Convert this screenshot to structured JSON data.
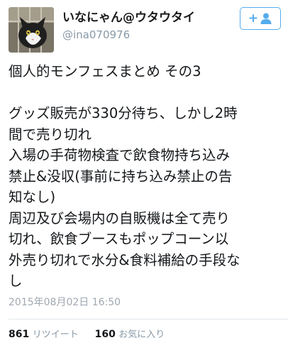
{
  "user": {
    "display_name": "いなにゃん@ウタウタイ",
    "screen_name": "@ina070976"
  },
  "follow_button": {
    "icon": "add-user-icon",
    "label": "+"
  },
  "tweet": {
    "lines": [
      "個人的モンフェスまとめ その3",
      "",
      "グッズ販売が330分待ち、しかし2時",
      "間で売り切れ",
      "入場の手荷物検査で飲食物持ち込み",
      "禁止&没収(事前に持ち込み禁止の告",
      "知なし)",
      "周辺及び会場内の自販機は全て売り",
      "切れ、飲食ブースもポップコーン以",
      "外売り切れで水分&食料補給の手段な",
      "し"
    ],
    "timestamp": "2015年08月02日 16:50"
  },
  "stats": {
    "retweet_count": "861",
    "retweet_label": "リツイート",
    "like_count": "160",
    "like_label": "お気に入り"
  },
  "colors": {
    "accent": "#55acee",
    "text": "#14171a",
    "muted": "#8899a6"
  }
}
